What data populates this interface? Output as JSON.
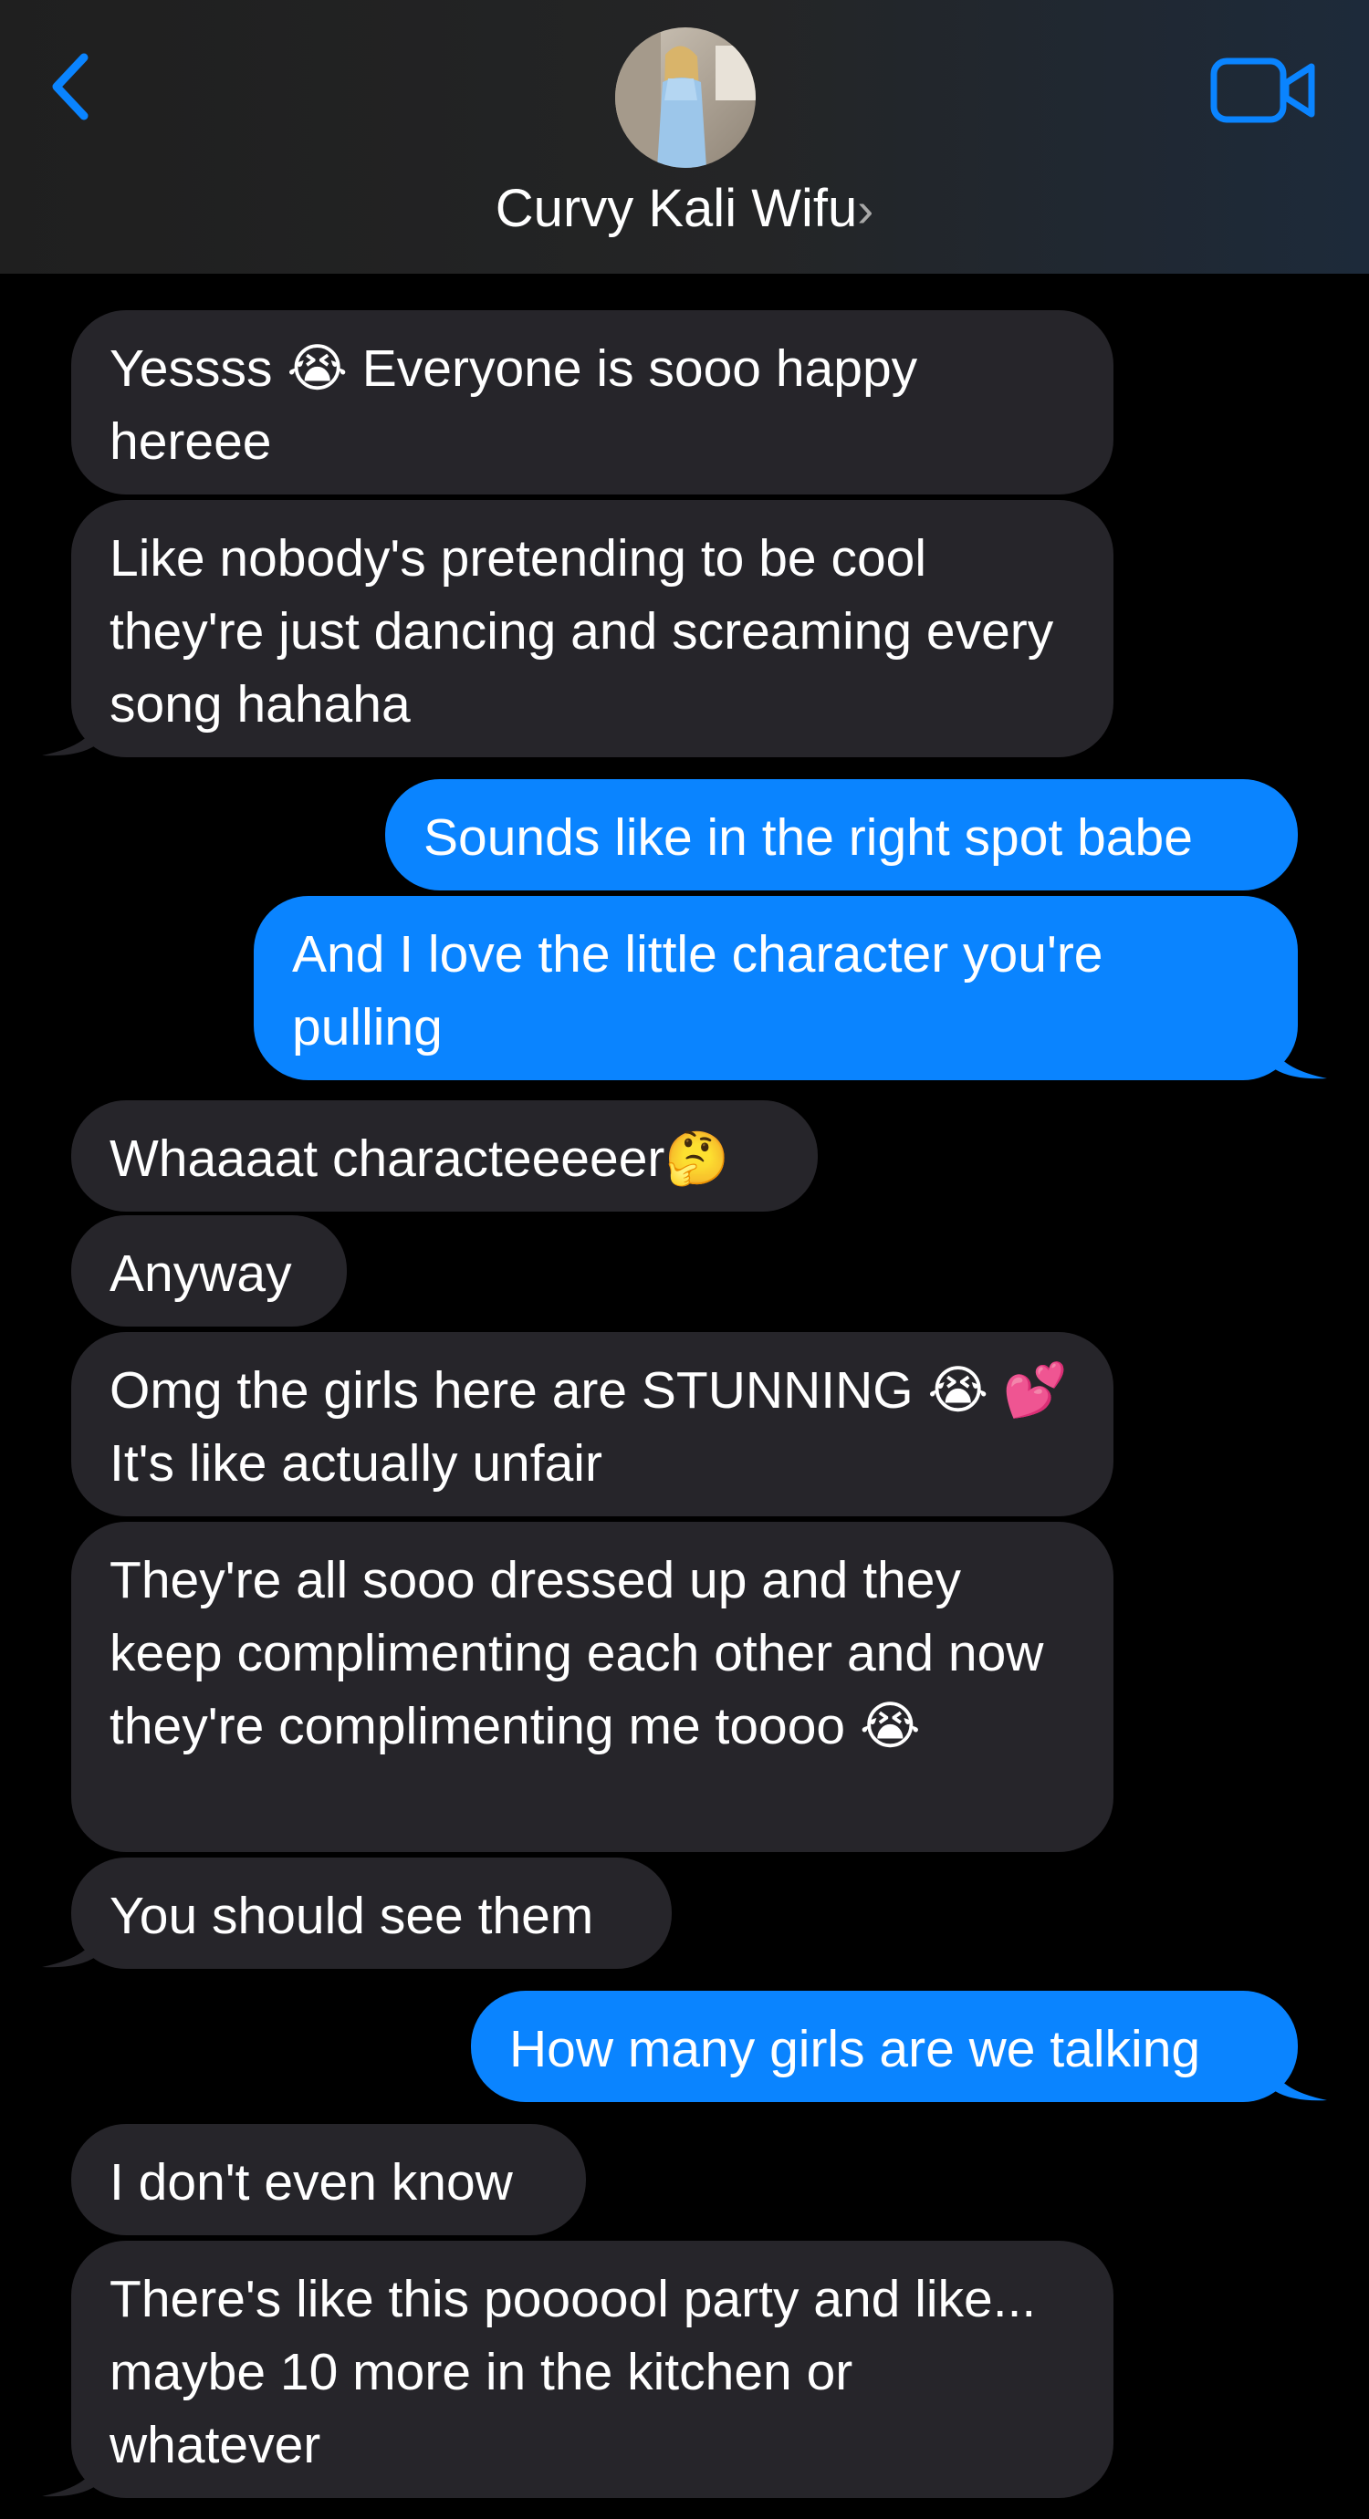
{
  "header": {
    "contact_name": "Curvy Kali Wifu",
    "chevron": "›",
    "back_icon": "chevron-left-icon",
    "video_icon": "video-camera-icon",
    "accent_color": "#0a84ff"
  },
  "messages": [
    {
      "direction": "incoming",
      "text": "Yessss 😭 Everyone is sooo happy hereee"
    },
    {
      "direction": "incoming",
      "text": "Like nobody's pretending to be cool they're just dancing and screaming every song hahaha"
    },
    {
      "direction": "outgoing",
      "text": "Sounds like in the right spot babe"
    },
    {
      "direction": "outgoing",
      "text": "And I love the little character you're pulling"
    },
    {
      "direction": "incoming",
      "text": "Whaaaat characteeeeer🤔"
    },
    {
      "direction": "incoming",
      "text": "Anyway"
    },
    {
      "direction": "incoming",
      "text": "Omg the girls here are STUNNING 😭 💕 It's like actually unfair"
    },
    {
      "direction": "incoming",
      "text": "They're all sooo dressed up and they keep complimenting each other and now they're complimenting me toooo 😭"
    },
    {
      "direction": "incoming",
      "text": "You should see them"
    },
    {
      "direction": "outgoing",
      "text": "How many girls are we talking"
    },
    {
      "direction": "incoming",
      "text": "I don't even know"
    },
    {
      "direction": "incoming",
      "text": "There's like this poooool party and like... maybe 10 more in the kitchen or whatever"
    }
  ]
}
